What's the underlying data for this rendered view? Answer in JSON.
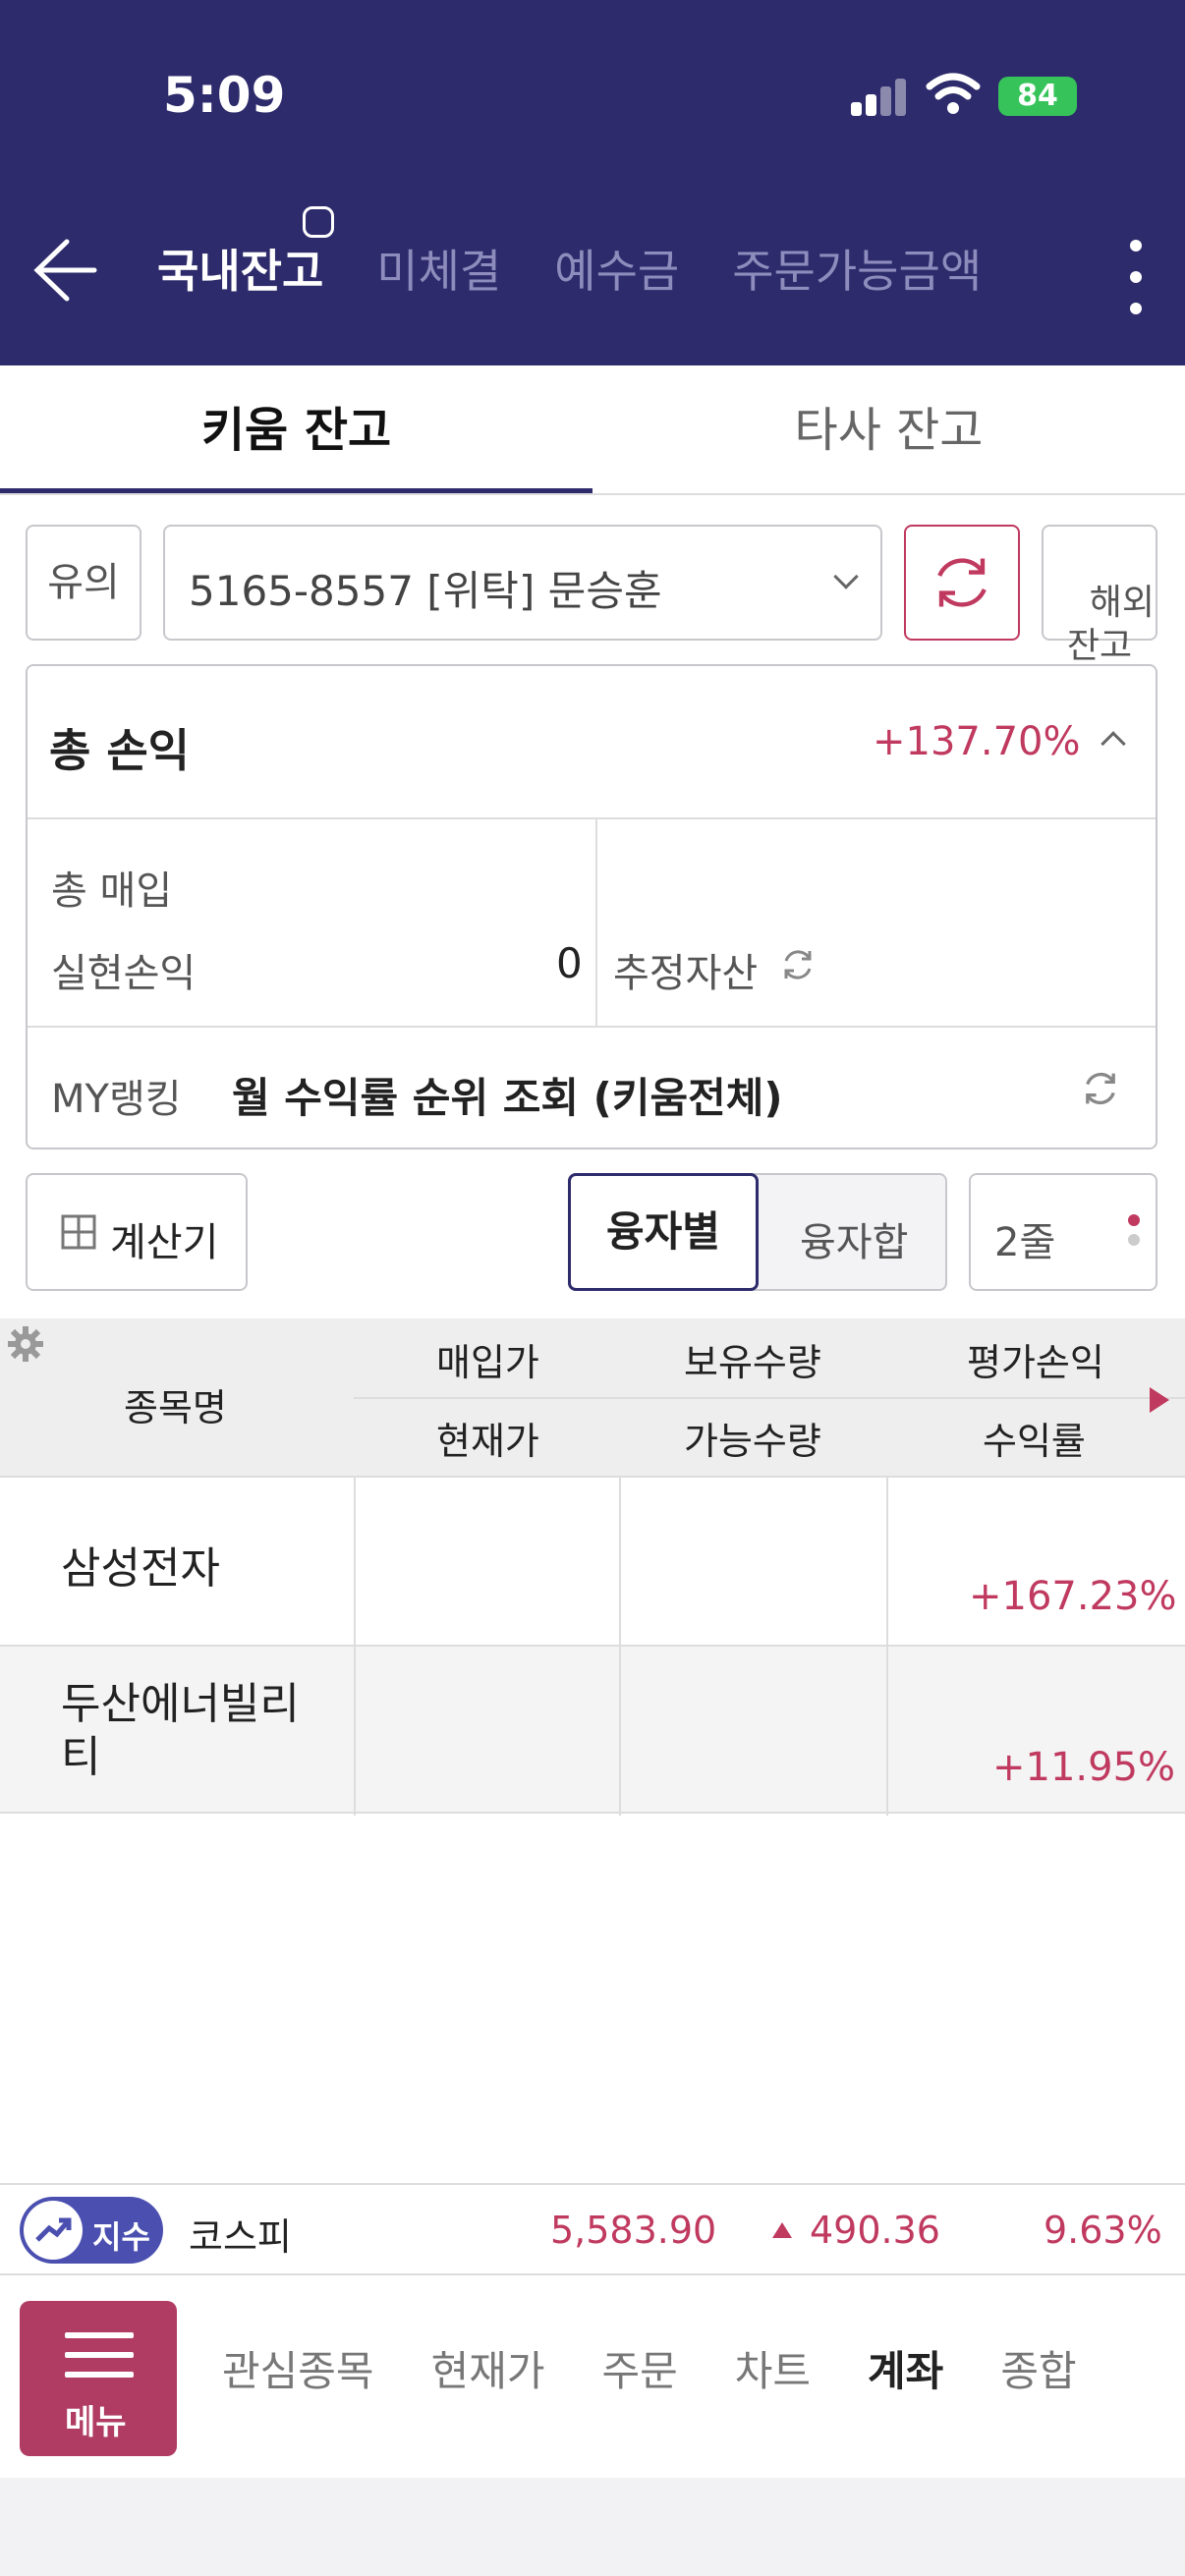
{
  "status_bar": {
    "time": "5:09",
    "battery": "84"
  },
  "header": {
    "tabs": [
      {
        "label": "국내잔고",
        "active": true
      },
      {
        "label": "미체결"
      },
      {
        "label": "예수금"
      },
      {
        "label": "주문가능금액"
      }
    ]
  },
  "subtabs": [
    {
      "label": "키움 잔고",
      "active": true
    },
    {
      "label": "타사 잔고"
    }
  ],
  "account": {
    "notice": "유의",
    "account_text": "5165-8557 [위탁] 문승훈",
    "overseas": "해외\n잔고"
  },
  "summary": {
    "total_label": "총 손익",
    "total_rate": "+137.70%",
    "purchase_label": "총 매입",
    "realized_label": "실현손익",
    "realized_value": "0",
    "estimated_label": "추정자산",
    "myranking_label": "MY랭킹",
    "myranking_text": "월 수익률 순위 조회 (키움전체)"
  },
  "controls": {
    "calculator": "계산기",
    "by_loan": "융자별",
    "loan_sum": "융자합",
    "lines": "2줄"
  },
  "table": {
    "headers": {
      "name": "종목명",
      "buy_price": "매입가",
      "current_price": "현재가",
      "holding_qty": "보유수량",
      "available_qty": "가능수량",
      "eval_pl": "평가손익",
      "return_rate": "수익률"
    },
    "rows": [
      {
        "name": "삼성전자",
        "return_rate": "+167.23%"
      },
      {
        "name": "두산에너빌리\n티",
        "return_rate": "+11.95%"
      }
    ]
  },
  "ticker": {
    "badge": "지수",
    "index_name": "코스피",
    "value": "5,583.90",
    "change": "490.36",
    "change_rate": "9.63%"
  },
  "bottom_nav": {
    "menu": "메뉴",
    "items": [
      {
        "label": "관심종목"
      },
      {
        "label": "현재가"
      },
      {
        "label": "주문"
      },
      {
        "label": "차트"
      },
      {
        "label": "계좌",
        "active": true
      },
      {
        "label": "종합"
      }
    ]
  },
  "colors": {
    "header_bg": "#2d2b6b",
    "accent_red": "#c0395f",
    "menu_bg": "#b03b63"
  }
}
